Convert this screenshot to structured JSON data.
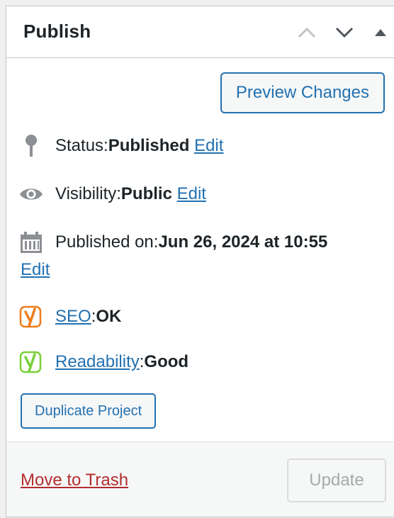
{
  "header": {
    "title": "Publish"
  },
  "actions": {
    "preview_label": "Preview Changes"
  },
  "status": {
    "label": "Status: ",
    "value": "Published",
    "edit": "Edit"
  },
  "visibility": {
    "label": "Visibility: ",
    "value": "Public",
    "edit": "Edit"
  },
  "published": {
    "label": "Published on: ",
    "value": "Jun 26, 2024 at 10:55",
    "edit": "Edit"
  },
  "seo": {
    "label": "SEO",
    "sep": ": ",
    "value": "OK",
    "color": "#ee7c1b"
  },
  "readability": {
    "label": "Readability",
    "sep": ": ",
    "value": "Good",
    "color": "#7ad03a"
  },
  "duplicate_label": "Duplicate Project",
  "footer": {
    "trash_label": "Move to Trash",
    "update_label": "Update"
  },
  "colors": {
    "accent": "#2271b1",
    "danger": "#b32d2e"
  }
}
